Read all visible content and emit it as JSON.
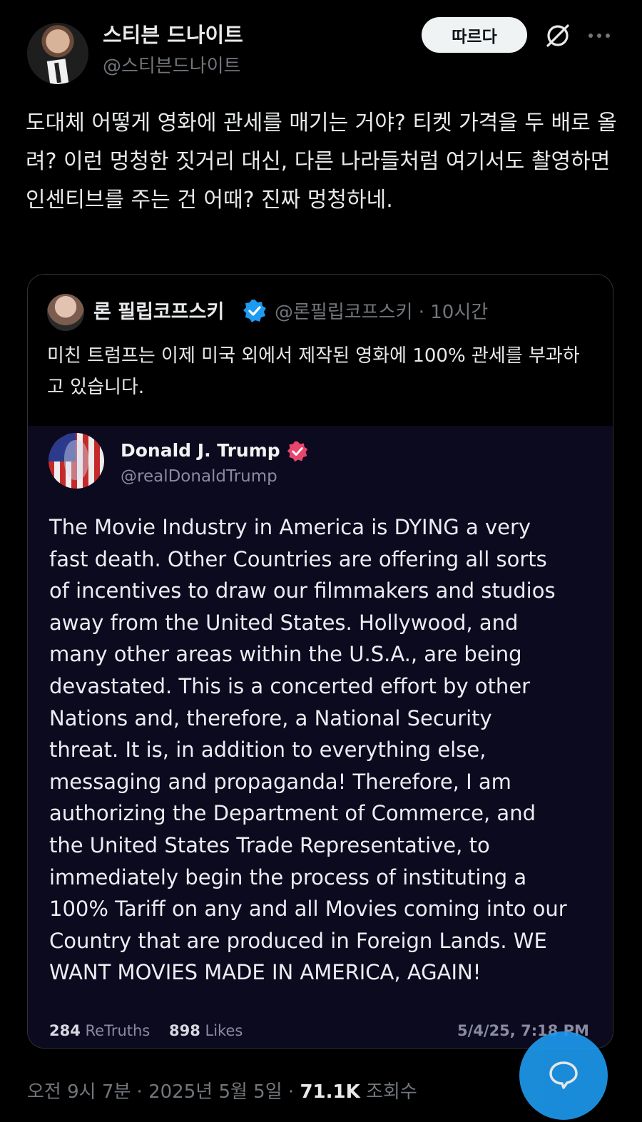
{
  "post": {
    "author_name": "스티븐 드나이트",
    "author_handle": "@스티븐드나이트",
    "follow_label": "따르다",
    "text": "도대체 어떻게 영화에 관세를 매기는 거야? 티켓 가격을 두 배로 올려? 이런 멍청한 짓거리 대신, 다른 나라들처럼 여기서도 촬영하면 인센티브를 주는 건 어때? 진짜 멍청하네.",
    "time": "오전 9시 7분",
    "date": "2025년 5월 5일",
    "views_count": "71.1K",
    "views_label": "조회수"
  },
  "quote": {
    "author_name": "론 필립코프스키",
    "author_handle": "@론필립코프스키",
    "age": "10시간",
    "text": "미친 트럼프는 이제 미국 외에서 제작된 영화에 100% 관세를 부과하고 있습니다."
  },
  "truth_post": {
    "author_name": "Donald J. Trump",
    "author_handle": "@realDonaldTrump",
    "body_lines": [
      "The Movie Industry in America is DYING a very",
      "fast death. Other Countries are offering all sorts",
      "of incentives to draw our filmmakers and studios",
      "away from the United States. Hollywood, and",
      "many other areas within the U.S.A., are being",
      "devastated. This is a concerted effort by other",
      "Nations and, therefore, a National Security",
      "threat. It is, in addition to everything else,",
      "messaging and propaganda! Therefore, I am",
      "authorizing the Department of Commerce, and",
      "the United States Trade Representative, to",
      "immediately begin the process of instituting a",
      "100% Tariff on any and all Movies coming into our",
      "Country that are produced in Foreign Lands. WE",
      "WANT MOVIES MADE IN AMERICA, AGAIN!"
    ],
    "retruths_count": "284",
    "retruths_label": "ReTruths",
    "likes_count": "898",
    "likes_label": "Likes",
    "timestamp": "5/4/25, 7:18 PM"
  },
  "icons": {
    "grok": "slash-circle-icon",
    "more": "more-horizontal-icon",
    "verified": "verified-badge-icon",
    "reply_fab": "chat-bubble-icon"
  },
  "colors": {
    "background": "#000000",
    "text_primary": "#e7e9ea",
    "text_secondary": "#71767b",
    "accent_blue": "#1d9bf0",
    "truth_verified": "#e9466d",
    "media_background": "#0b0a1e"
  }
}
